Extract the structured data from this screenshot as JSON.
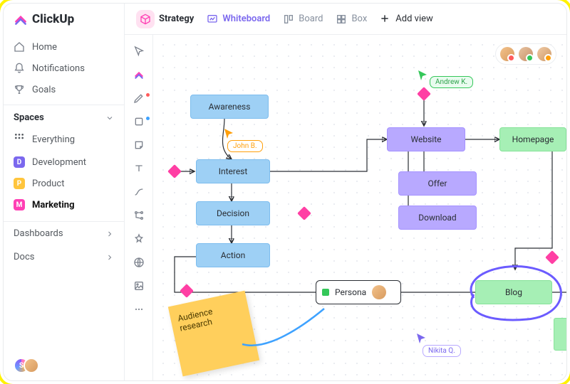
{
  "brand": {
    "name": "ClickUp"
  },
  "sidebar": {
    "nav": [
      {
        "label": "Home"
      },
      {
        "label": "Notifications"
      },
      {
        "label": "Goals"
      }
    ],
    "spaces_header": "Spaces",
    "spaces": [
      {
        "label": "Everything"
      },
      {
        "letter": "D",
        "label": "Development",
        "color": "#7b68ee"
      },
      {
        "letter": "P",
        "label": "Product",
        "color": "#ffc53d"
      },
      {
        "letter": "M",
        "label": "Marketing",
        "color": "#ff3fb4"
      }
    ],
    "sections": [
      {
        "label": "Dashboards"
      },
      {
        "label": "Docs"
      }
    ],
    "bottom_avatar_letter": "S"
  },
  "topbar": {
    "strategy_label": "Strategy",
    "views": [
      {
        "label": "Whiteboard"
      },
      {
        "label": "Board"
      },
      {
        "label": "Box"
      }
    ],
    "add_view": "Add view"
  },
  "canvas": {
    "nodes": {
      "awareness": "Awareness",
      "interest": "Interest",
      "decision": "Decision",
      "action": "Action",
      "website": "Website",
      "offer": "Offer",
      "download": "Download",
      "homepage": "Homepage",
      "blog": "Blog",
      "persona": "Persona"
    },
    "sticky": "Audience research",
    "users": {
      "john": "John B.",
      "andrew": "Andrew K.",
      "nikita": "Nikita Q."
    },
    "presence_colors": [
      "#ff5b5b",
      "#34c759",
      "#ff9f0a"
    ]
  }
}
